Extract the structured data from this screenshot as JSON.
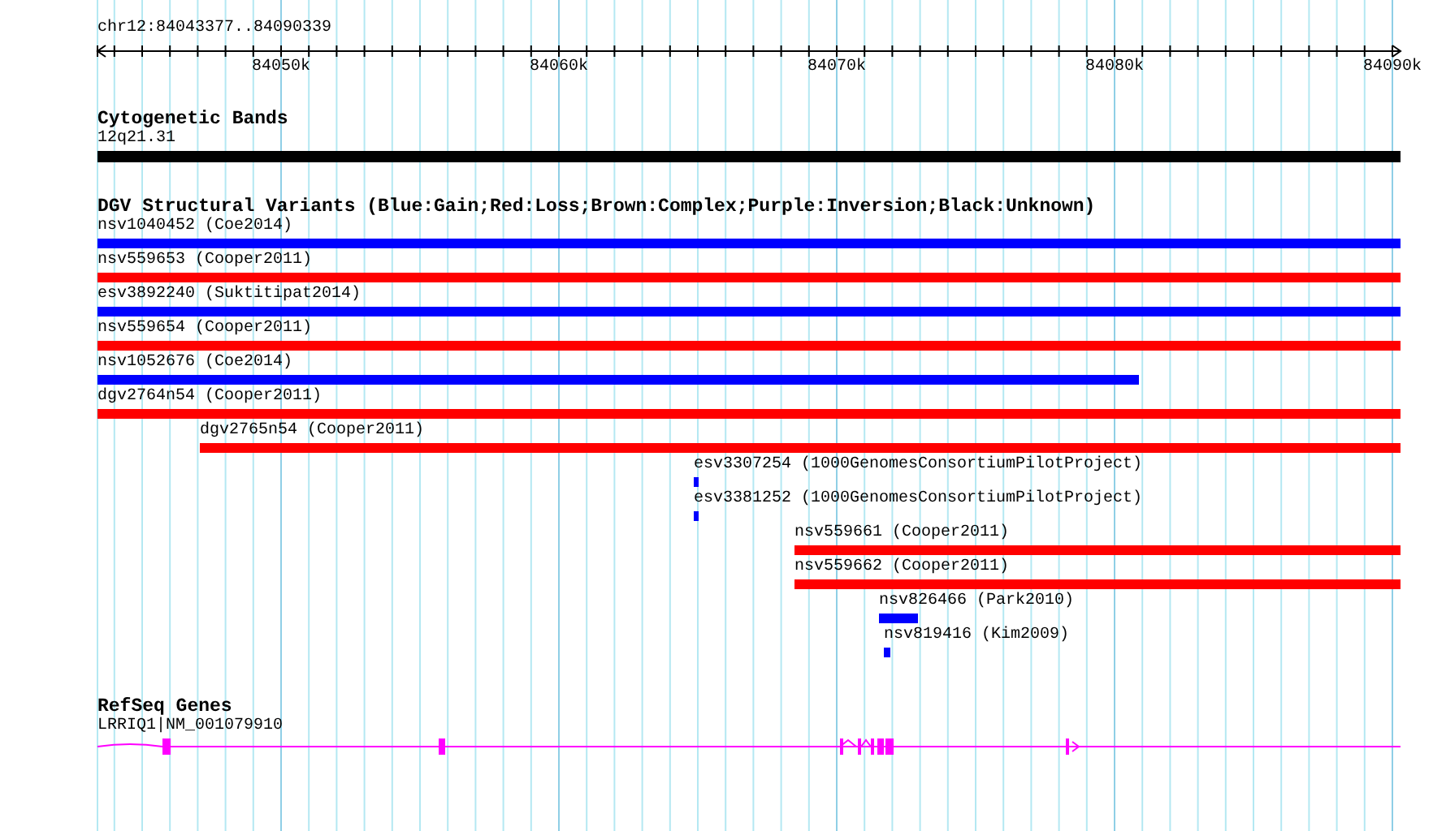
{
  "ruler": {
    "position": "chr12:84043377..84090339",
    "ticks": [
      "84050k",
      "84060k",
      "84070k",
      "84080k",
      "84090k"
    ]
  },
  "tracks": [
    {
      "kind": "cytoband",
      "title": "Cytogenetic Bands",
      "features": [
        {
          "label": "12q21.31"
        }
      ]
    },
    {
      "kind": "variants",
      "title": "DGV Structural Variants (Blue:Gain;Red:Loss;Brown:Complex;Purple:Inversion;Black:Unknown)",
      "features": [
        {
          "label": "nsv1040452 (Coe2014)",
          "color": "#0000ff"
        },
        {
          "label": "nsv559653 (Cooper2011)",
          "color": "#ff0000"
        },
        {
          "label": "esv3892240 (Suktitipat2014)",
          "color": "#0000ff"
        },
        {
          "label": "nsv559654 (Cooper2011)",
          "color": "#ff0000"
        },
        {
          "label": "nsv1052676 (Coe2014)",
          "color": "#0000ff"
        },
        {
          "label": "dgv2764n54 (Cooper2011)",
          "color": "#ff0000"
        },
        {
          "label": "dgv2765n54 (Cooper2011)",
          "color": "#ff0000"
        },
        {
          "label": "esv3307254 (1000GenomesConsortiumPilotProject)",
          "color": "#0000ff"
        },
        {
          "label": "esv3381252 (1000GenomesConsortiumPilotProject)",
          "color": "#0000ff"
        },
        {
          "label": "nsv559661 (Cooper2011)",
          "color": "#ff0000"
        },
        {
          "label": "nsv559662 (Cooper2011)",
          "color": "#ff0000"
        },
        {
          "label": "nsv826466 (Park2010)",
          "color": "#0000ff"
        },
        {
          "label": "nsv819416 (Kim2009)",
          "color": "#0000ff"
        }
      ]
    },
    {
      "kind": "genes",
      "title": "RefSeq Genes",
      "features": [
        {
          "label": "LRRIQ1|NM_001079910"
        }
      ]
    }
  ]
}
